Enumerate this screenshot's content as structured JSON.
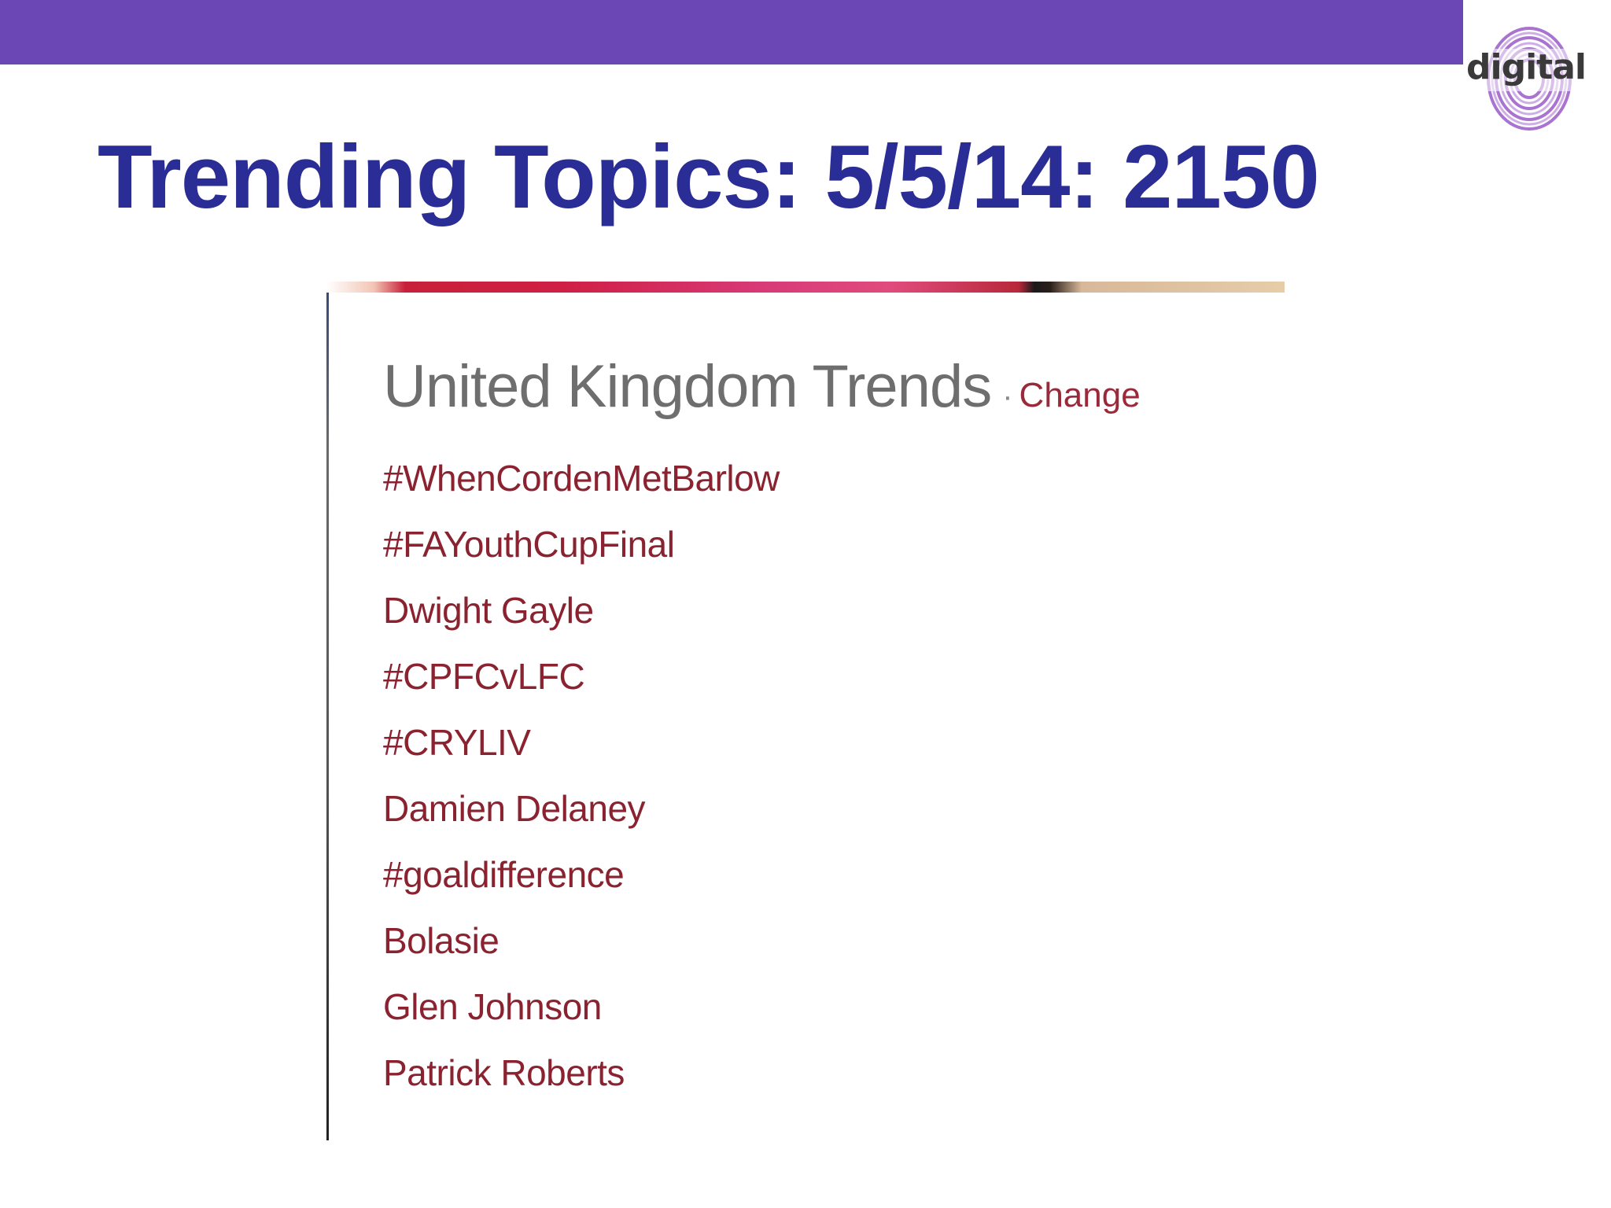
{
  "slide": {
    "title": "Trending Topics: 5/5/14: 2150",
    "logo_text": "digital",
    "accent_color": "#6b47b6",
    "title_color": "#2b2d96"
  },
  "trends_panel": {
    "title": "United Kingdom Trends",
    "separator": "·",
    "change_label": "Change",
    "link_color": "#8a2230",
    "items": [
      "#WhenCordenMetBarlow",
      "#FAYouthCupFinal",
      "Dwight Gayle",
      "#CPFCvLFC",
      "#CRYLIV",
      "Damien Delaney",
      "#goaldifference",
      "Bolasie",
      "Glen Johnson",
      "Patrick Roberts"
    ]
  }
}
